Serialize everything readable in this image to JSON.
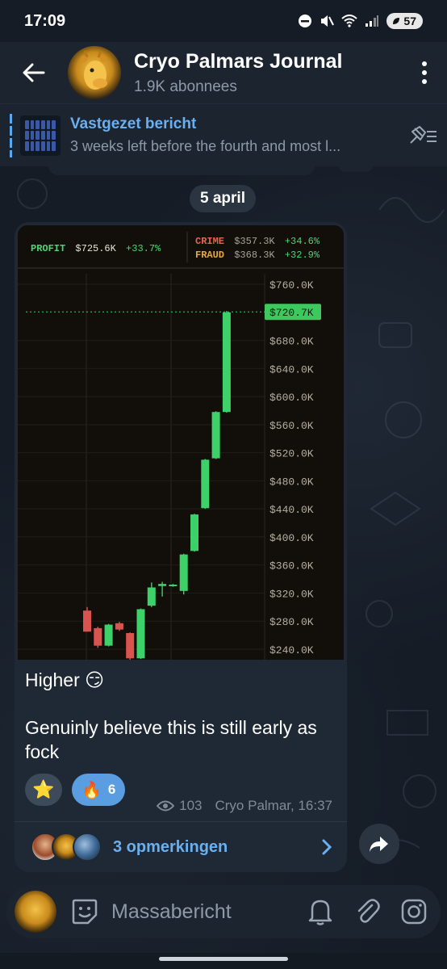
{
  "status_bar": {
    "time": "17:09",
    "battery": "57"
  },
  "header": {
    "title": "Cryo Palmars Journal",
    "subtitle": "1.9K abonnees"
  },
  "pinned": {
    "label": "Vastgezet bericht",
    "preview": "3 weeks left before the fourth and most l..."
  },
  "date_chip": "5 april",
  "message": {
    "line1": "Higher 😏",
    "line2": "Genuinly believe this is still early as fock",
    "reactions": [
      {
        "emoji": "⭐",
        "count": ""
      },
      {
        "emoji": "🔥",
        "count": "6"
      }
    ],
    "views": "103",
    "author_time": "Cryo Palmar, 16:37",
    "comments_label": "3 opmerkingen"
  },
  "input": {
    "placeholder": "Massabericht"
  },
  "colors": {
    "accent": "#6ab0f0",
    "up": "#3ed069",
    "down": "#d9534f",
    "profit_label": "#4cd670",
    "crime_label": "#e2664a",
    "fraud_label": "#e8a83a"
  },
  "chart_data": {
    "type": "candlestick",
    "legend": {
      "profit": {
        "label": "PROFIT",
        "value": "$725.6K",
        "change": "+33.7%"
      },
      "crime": {
        "label": "CRIME",
        "value": "$357.3K",
        "change": "+34.6%"
      },
      "fraud": {
        "label": "FRAUD",
        "value": "$368.3K",
        "change": "+32.9%"
      }
    },
    "y_ticks": [
      "$760.0K",
      "$720.7K",
      "$680.0K",
      "$640.0K",
      "$600.0K",
      "$560.0K",
      "$520.0K",
      "$480.0K",
      "$440.0K",
      "$400.0K",
      "$360.0K",
      "$320.0K",
      "$280.0K",
      "$240.0K"
    ],
    "ylim": [
      225,
      775
    ],
    "current_price": 720.7,
    "candles": [
      {
        "o": 295,
        "c": 265,
        "h": 300,
        "l": 265
      },
      {
        "o": 270,
        "c": 245,
        "h": 272,
        "l": 242
      },
      {
        "o": 245,
        "c": 275,
        "h": 276,
        "l": 244
      },
      {
        "o": 277,
        "c": 268,
        "h": 279,
        "l": 266
      },
      {
        "o": 263,
        "c": 227,
        "h": 264,
        "l": 225
      },
      {
        "o": 227,
        "c": 297,
        "h": 298,
        "l": 226
      },
      {
        "o": 302,
        "c": 328,
        "h": 335,
        "l": 300
      },
      {
        "o": 330,
        "c": 333,
        "h": 336,
        "l": 315
      },
      {
        "o": 330,
        "c": 332,
        "h": 333,
        "l": 329
      },
      {
        "o": 323,
        "c": 375,
        "h": 376,
        "l": 318
      },
      {
        "o": 380,
        "c": 432,
        "h": 433,
        "l": 379
      },
      {
        "o": 441,
        "c": 510,
        "h": 511,
        "l": 440
      },
      {
        "o": 512,
        "c": 578,
        "h": 579,
        "l": 511
      },
      {
        "o": 578,
        "c": 720,
        "h": 722,
        "l": 577
      }
    ]
  }
}
